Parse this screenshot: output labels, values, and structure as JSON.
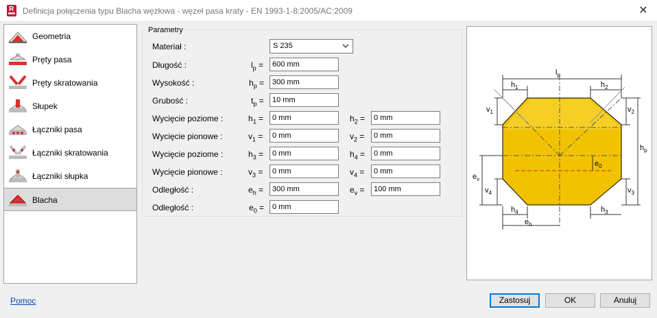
{
  "window": {
    "title": "Definicja połączenia typu Blacha węzłowa - węzeł pasa kraty - EN 1993-1-8:2005/AC:2009",
    "app_icon_letter": "R"
  },
  "sidebar": {
    "items": [
      {
        "label": "Geometria",
        "icon": "geometry-icon"
      },
      {
        "label": "Pręty pasa",
        "icon": "chord-members-icon"
      },
      {
        "label": "Pręty skratowania",
        "icon": "bracing-members-icon"
      },
      {
        "label": "Słupek",
        "icon": "post-icon"
      },
      {
        "label": "Łączniki pasa",
        "icon": "chord-connectors-icon"
      },
      {
        "label": "Łączniki skratowania",
        "icon": "bracing-connectors-icon"
      },
      {
        "label": "Łączniki słupka",
        "icon": "post-connectors-icon"
      },
      {
        "label": "Blacha",
        "icon": "plate-icon",
        "active": true
      }
    ]
  },
  "params": {
    "group_title": "Parametry",
    "material": {
      "label": "Materiał :",
      "value": "S 235"
    },
    "length": {
      "label": "Długość :",
      "sym": "l",
      "sub": "p",
      "value": "600 mm"
    },
    "height": {
      "label": "Wysokość :",
      "sym": "h",
      "sub": "p",
      "value": "300 mm"
    },
    "thickness": {
      "label": "Grubość :",
      "sym": "t",
      "sub": "p",
      "value": "10 mm"
    },
    "cut_h12": {
      "label": "Wycięcie poziome :",
      "sym1": "h",
      "sub1": "1",
      "value1": "0 mm",
      "sym2": "h",
      "sub2": "2",
      "value2": "0 mm"
    },
    "cut_v12": {
      "label": "Wycięcie pionowe :",
      "sym1": "v",
      "sub1": "1",
      "value1": "0 mm",
      "sym2": "v",
      "sub2": "2",
      "value2": "0 mm"
    },
    "cut_h34": {
      "label": "Wycięcie poziome :",
      "sym1": "h",
      "sub1": "3",
      "value1": "0 mm",
      "sym2": "h",
      "sub2": "4",
      "value2": "0 mm"
    },
    "cut_v34": {
      "label": "Wycięcie pionowe :",
      "sym1": "v",
      "sub1": "3",
      "value1": "0 mm",
      "sym2": "v",
      "sub2": "4",
      "value2": "0 mm"
    },
    "dist_e": {
      "label": "Odległość :",
      "sym1": "e",
      "sub1": "h",
      "value1": "300 mm",
      "sym2": "e",
      "sub2": "v",
      "value2": "100 mm"
    },
    "dist_e0": {
      "label": "Odległość :",
      "sym": "e",
      "sub": "0",
      "value": "0 mm"
    },
    "eq": "="
  },
  "diagram": {
    "labels": {
      "lp": "l",
      "lp_sub": "p",
      "hp": "h",
      "hp_sub": "p",
      "ev": "e",
      "ev_sub": "v",
      "eh": "e",
      "eh_sub": "h",
      "e0": "e",
      "e0_sub": "0",
      "h1": "h",
      "h1_sub": "1",
      "h2": "h",
      "h2_sub": "2",
      "h3": "h",
      "h3_sub": "3",
      "h4": "h",
      "h4_sub": "4",
      "v1": "v",
      "v1_sub": "1",
      "v2": "v",
      "v2_sub": "2",
      "v3": "v",
      "v3_sub": "3",
      "v4": "v",
      "v4_sub": "4"
    },
    "plate_color": "#f2c200"
  },
  "footer": {
    "help": "Pomoc",
    "apply": "Zastosuj",
    "ok": "OK",
    "cancel": "Anuluj"
  }
}
